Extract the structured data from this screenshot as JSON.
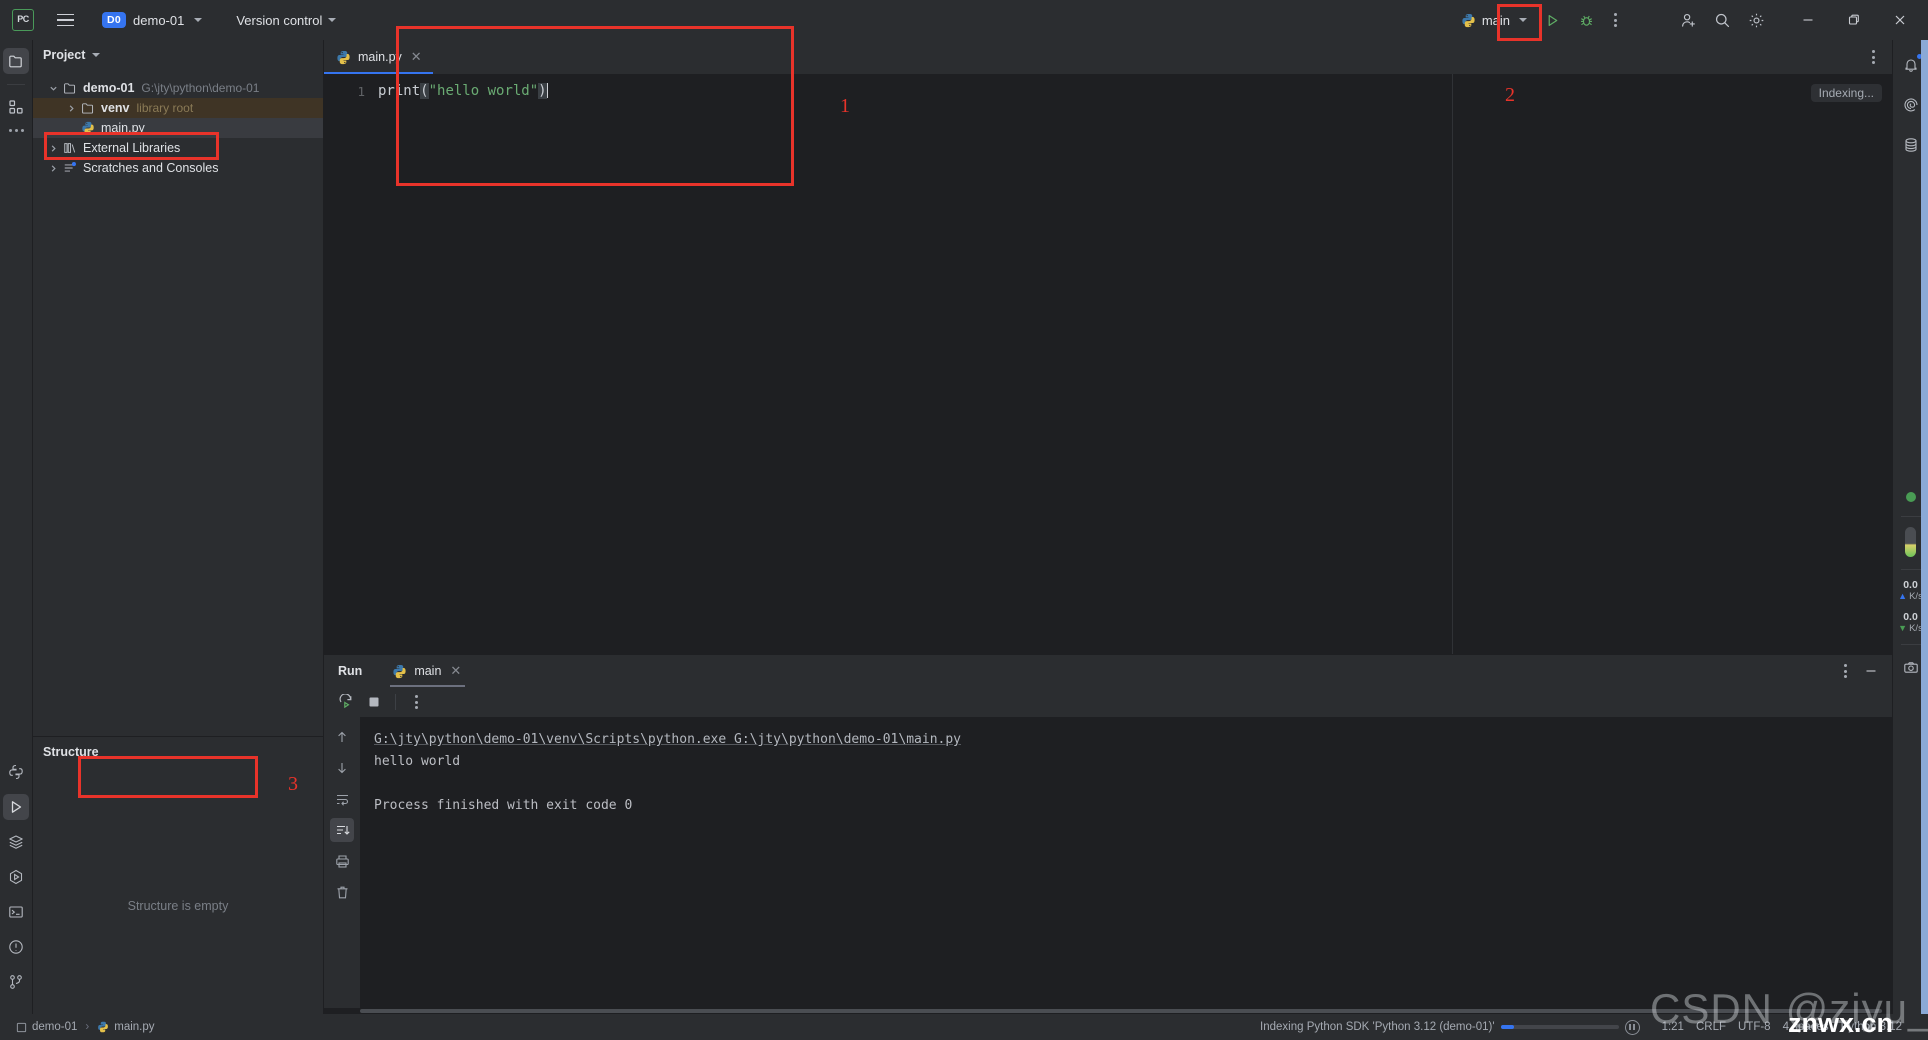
{
  "app": {
    "name": "PyCharm",
    "logo_text": "PC"
  },
  "titlebar": {
    "menu_icon": "hamburger-icon",
    "project_badge": "D0",
    "project_name": "demo-01",
    "version_control": "Version control",
    "run_config_name": "main",
    "run_icon": "run-triangle-icon",
    "debug_icon": "bug-icon",
    "more_icon": "vertical-dots-icon",
    "account_icon": "add-user-icon",
    "search_icon": "search-icon",
    "settings_icon": "gear-icon",
    "minimize_icon": "minimize-icon",
    "maximize_icon": "restore-icon",
    "close_icon": "close-icon"
  },
  "left_rail": {
    "top": [
      {
        "name": "project-icon",
        "glyph": "folder"
      },
      {
        "name": "structure-icon",
        "glyph": "blocks"
      },
      {
        "name": "more-tools-icon",
        "glyph": "dots"
      }
    ],
    "bottom": [
      {
        "name": "python-console-icon",
        "glyph": "python"
      },
      {
        "name": "run-tool-icon",
        "glyph": "play",
        "active": true
      },
      {
        "name": "services-icon",
        "glyph": "layers"
      },
      {
        "name": "run-anything-icon",
        "glyph": "hex-play"
      },
      {
        "name": "terminal-icon",
        "glyph": "terminal"
      },
      {
        "name": "problems-icon",
        "glyph": "exclaim"
      },
      {
        "name": "version-control-icon",
        "glyph": "git"
      }
    ]
  },
  "project_panel": {
    "title": "Project",
    "tree": [
      {
        "label": "demo-01",
        "sub": "G:\\jty\\python\\demo-01",
        "icon": "folder-icon",
        "indent": 0,
        "expanded": true,
        "bold": true
      },
      {
        "label": "venv",
        "sub": "library root",
        "icon": "folder-icon",
        "indent": 1,
        "expanded": false,
        "highlight": "venv"
      },
      {
        "label": "main.py",
        "sub": "",
        "icon": "python-file-icon",
        "indent": 2,
        "selected": true
      },
      {
        "label": "External Libraries",
        "sub": "",
        "icon": "library-icon",
        "indent": 0,
        "expanded": false
      },
      {
        "label": "Scratches and Consoles",
        "sub": "",
        "icon": "scratches-icon",
        "indent": 0,
        "expanded": false
      }
    ]
  },
  "structure_panel": {
    "title": "Structure",
    "empty_text": "Structure is empty"
  },
  "editor": {
    "tab_label": "main.py",
    "tab_icon": "python-file-icon",
    "close_icon": "close-icon",
    "options_icon": "vertical-dots-icon",
    "indexing_text": "Indexing...",
    "line_number": "1",
    "code": {
      "fn": "print",
      "open_paren": "(",
      "string": "\"hello world\"",
      "close_paren": ")"
    }
  },
  "run_panel": {
    "title": "Run",
    "tab_label": "main",
    "tab_icon": "python-file-icon",
    "tab_close_icon": "close-icon",
    "options_icon": "vertical-dots-icon",
    "minimize_icon": "minimize-icon",
    "toolbar": [
      {
        "name": "rerun-button",
        "glyph": "rerun"
      },
      {
        "name": "stop-button",
        "glyph": "stop"
      },
      {
        "name": "run-options-button",
        "glyph": "dots"
      }
    ],
    "console_rail": [
      {
        "name": "scroll-up-button",
        "glyph": "arrow-up"
      },
      {
        "name": "scroll-down-button",
        "glyph": "arrow-down"
      },
      {
        "name": "soft-wrap-button",
        "glyph": "wrap"
      },
      {
        "name": "scroll-to-end-button",
        "glyph": "scroll-end",
        "active": true
      },
      {
        "name": "print-button",
        "glyph": "printer"
      },
      {
        "name": "clear-all-button",
        "glyph": "trash"
      }
    ],
    "output": [
      "G:\\jty\\python\\demo-01\\venv\\Scripts\\python.exe G:\\jty\\python\\demo-01\\main.py",
      "hello world",
      "",
      "Process finished with exit code 0"
    ]
  },
  "right_rail": {
    "top": [
      {
        "name": "notifications-icon",
        "glyph": "bell",
        "badge": true
      },
      {
        "name": "ai-assistant-icon",
        "glyph": "spiral"
      },
      {
        "name": "database-icon",
        "glyph": "database"
      }
    ],
    "status_dot_color": "#499c54",
    "network_up": {
      "value": "0.0",
      "unit": "K/s"
    },
    "network_down": {
      "value": "0.0",
      "unit": "K/s"
    },
    "screenshot_icon": "camera-icon"
  },
  "statusbar": {
    "breadcrumb_project": "demo-01",
    "breadcrumb_file": "main.py",
    "indexing_message": "Indexing Python SDK 'Python 3.12 (demo-01)'",
    "pause_icon": "pause-icon",
    "caret_position": "1:21",
    "line_separator": "CRLF",
    "encoding": "UTF-8",
    "indent": "4 spaces",
    "interpreter": "Python 3.12"
  },
  "annotations": [
    {
      "label": "1"
    },
    {
      "label": "2"
    },
    {
      "label": "3"
    }
  ],
  "watermark": {
    "grey_text": "CSDN @ziyu_jia",
    "white_text": "znwx.cn"
  },
  "colors": {
    "accent": "#3574f0",
    "annotation": "#e8332a",
    "run_green": "#499c54",
    "string_green": "#6aab73",
    "venv_highlight": "#3f3425"
  }
}
